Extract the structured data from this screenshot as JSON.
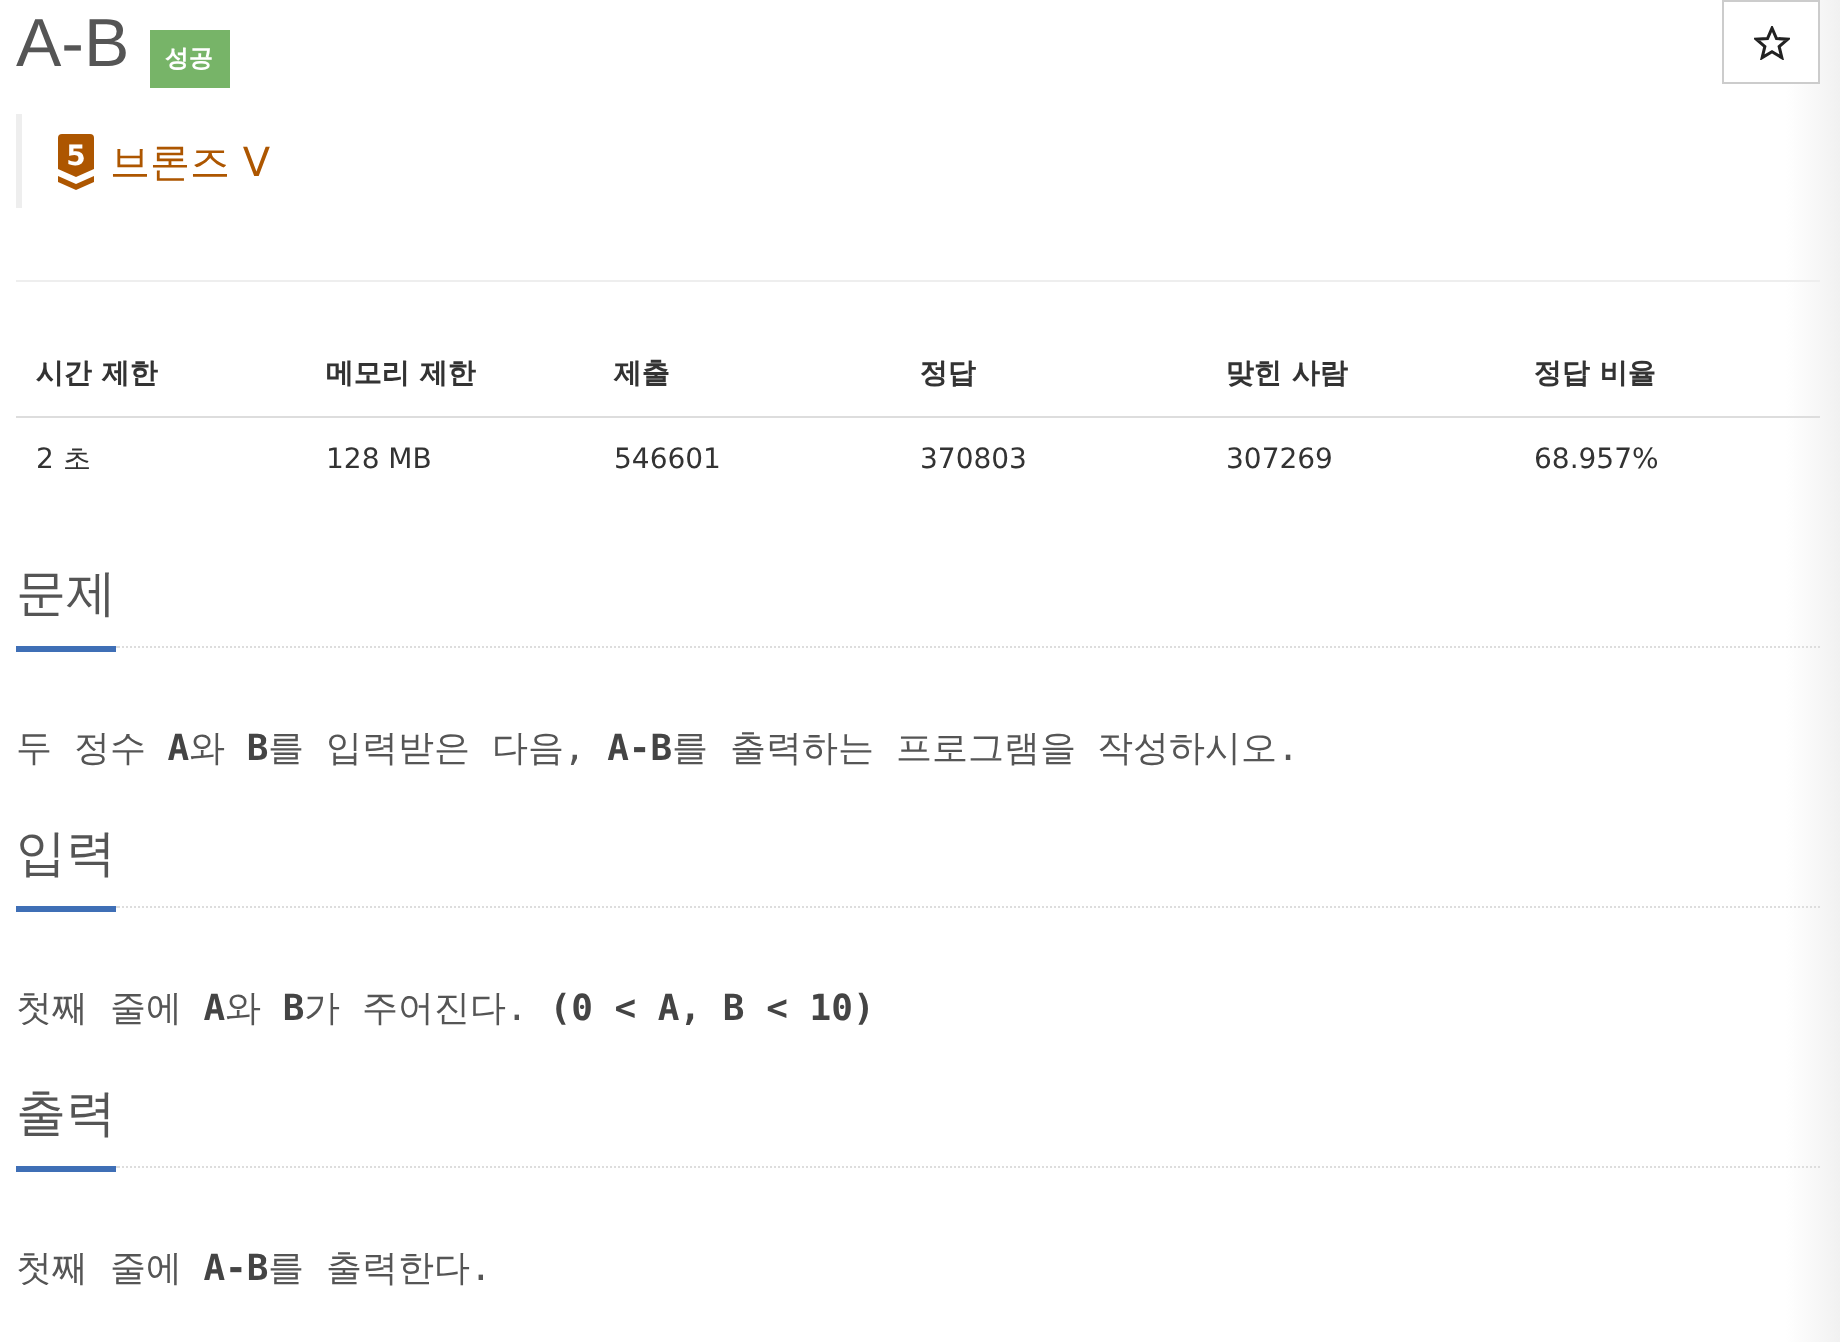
{
  "problem": {
    "title": "A-B",
    "result_badge": "성공",
    "bookmark": {
      "on": false
    },
    "tier": {
      "badge": "5",
      "name": "브론즈 V"
    }
  },
  "stats_table": {
    "columns": [
      "시간 제한",
      "메모리 제한",
      "제출",
      "정답",
      "맞힌 사람",
      "정답 비율"
    ],
    "rows": [
      [
        "2 초",
        "128 MB",
        "546601",
        "370803",
        "307269",
        "68.957%"
      ]
    ]
  },
  "sections": [
    {
      "heading": "문제",
      "text": "두 정수 **A**와 **B**를 입력받은 다음, **A-B**를 출력하는 프로그램을 작성하시오."
    },
    {
      "heading": "입력",
      "text": "첫째 줄에 **A**와 **B**가 주어진다. **(0 < A, B < 10)**"
    },
    {
      "heading": "출력",
      "text": "첫째 줄에 **A-B**를 출력한다."
    }
  ]
}
